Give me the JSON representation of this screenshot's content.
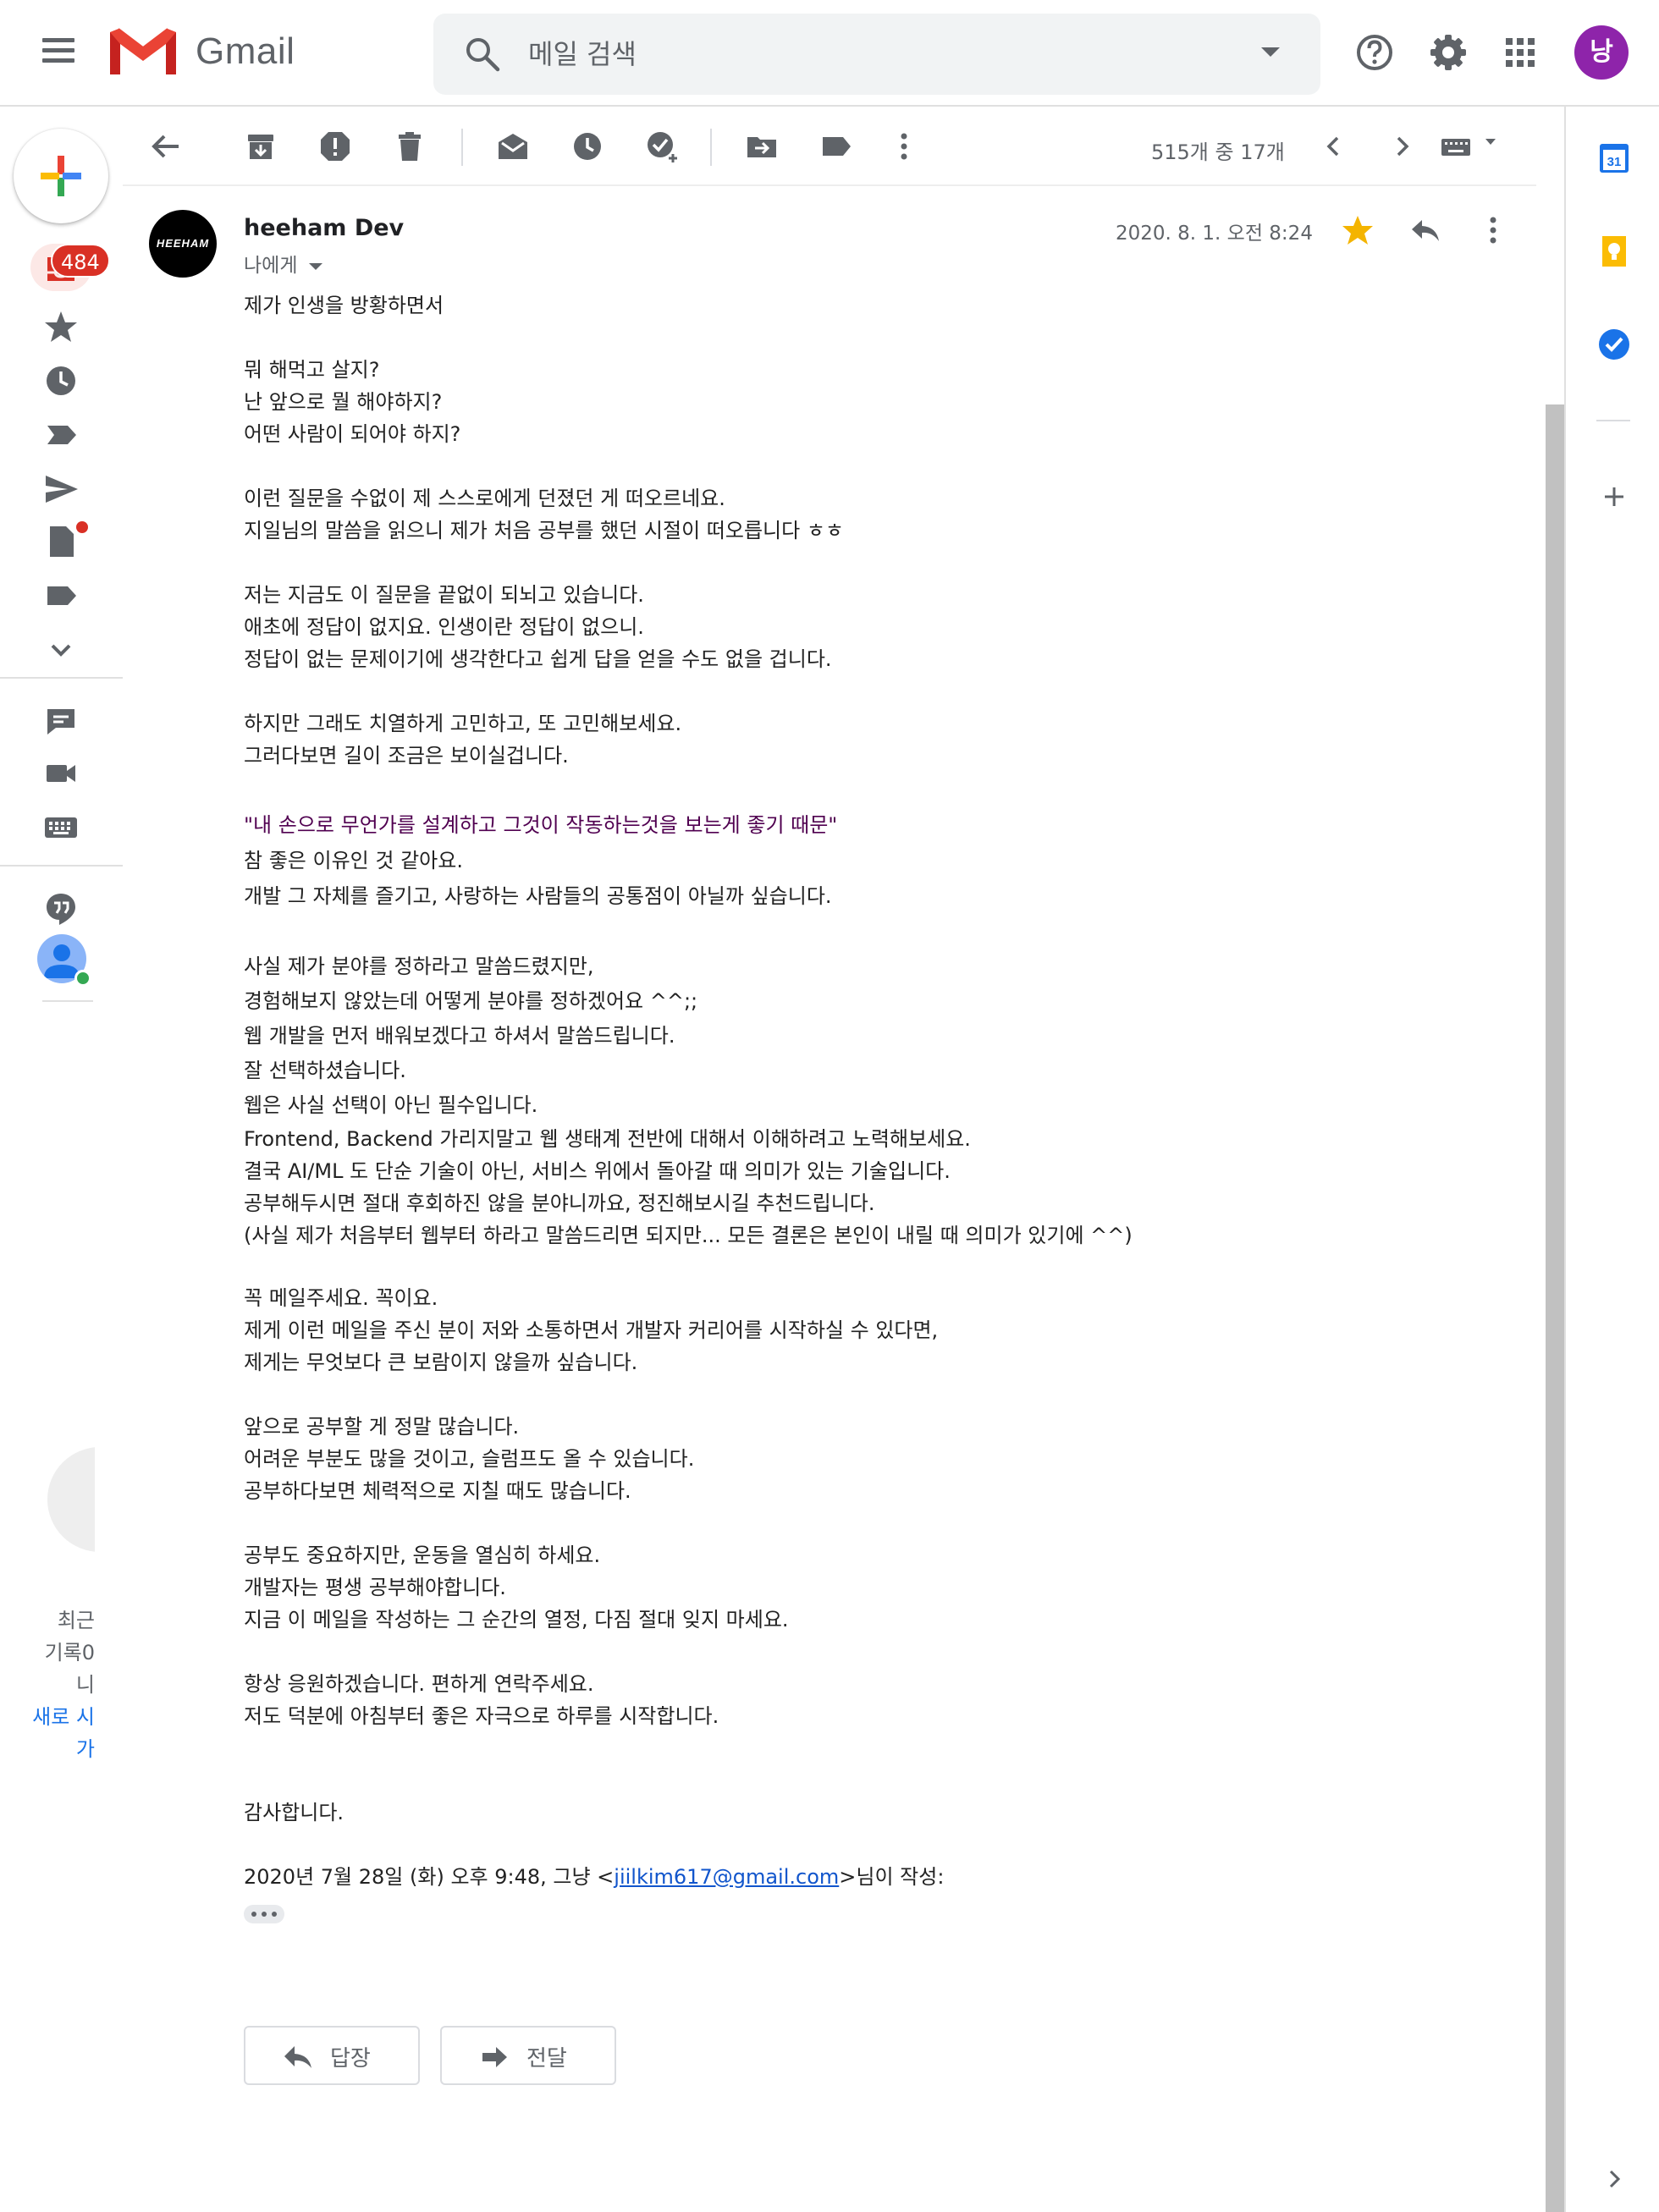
{
  "app": {
    "title": "Gmail",
    "search_placeholder": "메일 검색",
    "avatar_initial": "낭"
  },
  "sidebar": {
    "inbox_badge": "484",
    "hangouts": {
      "line1": "최근",
      "line2": "기록0",
      "line3": "니",
      "link": "새로 시",
      "line5": "가"
    }
  },
  "toolbar": {
    "pager_text": "515개 중 17개"
  },
  "message": {
    "sender_name": "heeham Dev",
    "sender_avatar_text": "HEEHAM",
    "recipient": "나에게",
    "date": "2020. 8. 1. 오전 8:24",
    "starred": true,
    "paragraphs": [
      [
        "제가 인생을 방황하면서"
      ],
      [
        "뭐 해먹고 살지?",
        "난 앞으로 뭘 해야하지?",
        "어떤 사람이 되어야 하지?"
      ],
      [
        "이런 질문을 수없이 제 스스로에게 던졌던 게 떠오르네요.",
        "지일님의 말씀을 읽으니 제가 처음 공부를 했던 시절이 떠오릅니다 ㅎㅎ"
      ],
      [
        "저는 지금도 이 질문을 끝없이 되뇌고 있습니다.",
        "애초에 정답이 없지요. 인생이란 정답이 없으니.",
        "정답이 없는 문제이기에 생각한다고 쉽게 답을 얻을 수도 없을 겁니다."
      ],
      [
        "하지만 그래도 치열하게 고민하고, 또 고민해보세요.",
        "그러다보면 길이 조금은 보이실겁니다."
      ]
    ],
    "quote": "\"내 손으로 무언가를 설계하고 그것이 작동하는것을 보는게 좋기 때문\"",
    "quote_followup": [
      "참 좋은 이유인 것 같아요.",
      "개발 그 자체를 즐기고, 사랑하는 사람들의 공통점이 아닐까 싶습니다."
    ],
    "tight_paragraph": [
      "사실 제가 분야를 정하라고 말씀드렸지만,",
      "경험해보지 않았는데 어떻게 분야를 정하겠어요 ^^;;",
      "웹 개발을 먼저 배워보겠다고 하셔서 말씀드립니다.",
      "잘 선택하셨습니다.",
      "웹은 사실 선택이 아닌 필수입니다.",
      "Frontend, Backend 가리지말고 웹 생태계 전반에 대해서 이해하려고 노력해보세요.",
      "결국 AI/ML 도 단순 기술이 아닌, 서비스 위에서 돌아갈 때 의미가 있는 기술입니다.",
      "공부해두시면 절대 후회하진 않을 분야니까요, 정진해보시길 추천드립니다.",
      "(사실 제가 처음부터 웹부터 하라고 말씀드리면 되지만... 모든 결론은 본인이 내릴 때 의미가 있기에 ^^)"
    ],
    "paragraphs2": [
      [
        "꼭 메일주세요. 꼭이요.",
        "제게 이런 메일을 주신 분이 저와 소통하면서 개발자 커리어를 시작하실 수 있다면,",
        "제게는 무엇보다 큰 보람이지 않을까 싶습니다."
      ],
      [
        "앞으로 공부할 게 정말 많습니다.",
        "어려운 부분도 많을 것이고, 슬럼프도 올 수 있습니다.",
        "공부하다보면 체력적으로 지칠 때도 많습니다."
      ],
      [
        "공부도 중요하지만, 운동을 열심히 하세요.",
        "개발자는 평생 공부해야합니다.",
        "지금 이 메일을 작성하는 그 순간의 열정, 다짐 절대 잊지 마세요."
      ],
      [
        "항상 응원하겠습니다. 편하게 연락주세요.",
        "저도 덕분에 아침부터 좋은 자극으로 하루를 시작합니다."
      ]
    ],
    "closing": "감사합니다.",
    "quoted_header": {
      "prefix": "2020년 7월 28일 (화) 오후 9:48, 그냥 <",
      "email": "jiilkim617@gmail.com",
      "suffix": ">님이 작성:"
    }
  },
  "actions": {
    "reply_label": "답장",
    "forward_label": "전달"
  },
  "side_panel": {
    "calendar_day": "31"
  },
  "colors": {
    "badge": "#d93025",
    "avatar": "#8e24aa",
    "star": "#f4b400",
    "quote": "#500050",
    "link": "#1155cc"
  }
}
